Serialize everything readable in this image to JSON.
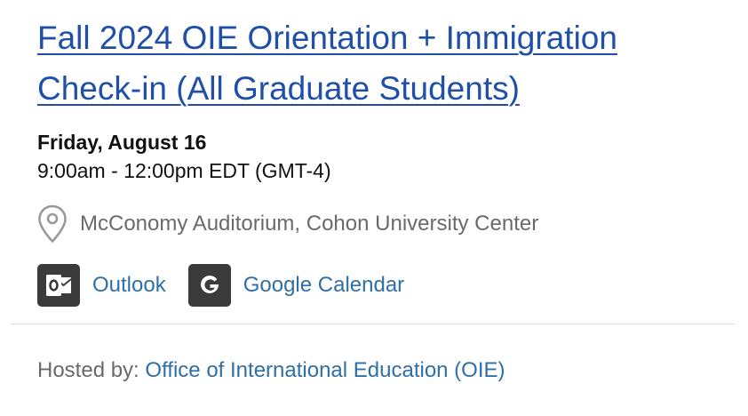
{
  "event": {
    "title": "Fall 2024 OIE Orientation + Immigration Check-in (All Graduate Students)",
    "date": "Friday, August 16",
    "time": "9:00am - 12:00pm EDT (GMT-4)",
    "location": "McConomy Auditorium, Cohon University Center",
    "location_icon": "map-pin-icon"
  },
  "calendar_links": {
    "outlook_label": "Outlook",
    "outlook_icon": "outlook-icon",
    "google_label": "Google Calendar",
    "google_icon": "google-icon"
  },
  "host": {
    "label": "Hosted by:",
    "name": "Office of International Education (OIE)"
  },
  "colors": {
    "title_link": "#1f4fa8",
    "link": "#2f6fa8",
    "muted_text": "#6a6a6a",
    "icon_bg": "#3b3b3b",
    "divider": "#dcdcdc"
  }
}
